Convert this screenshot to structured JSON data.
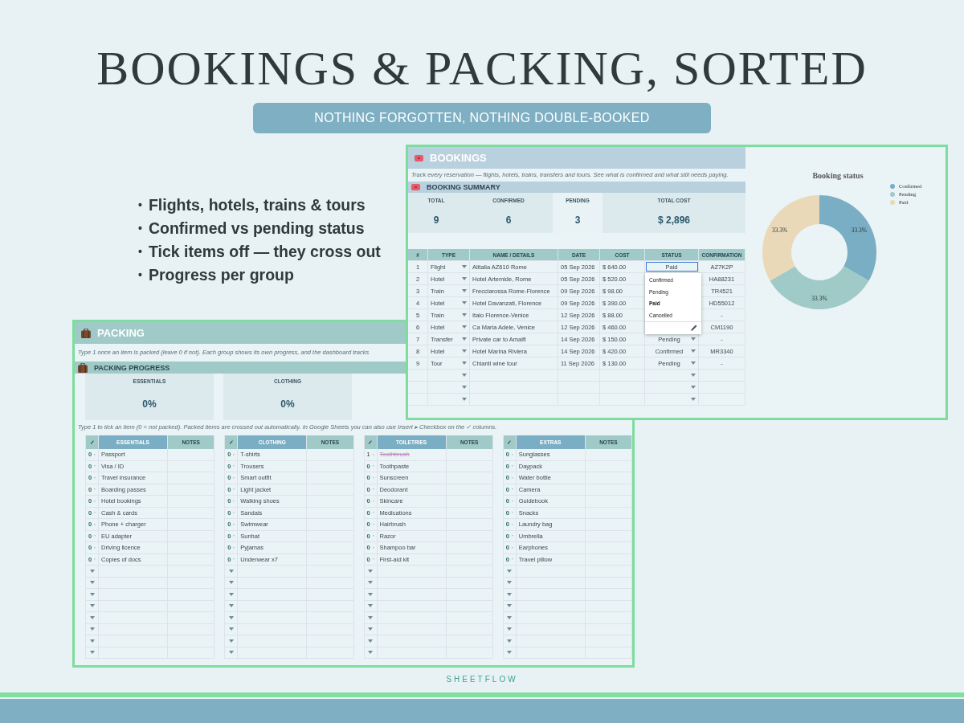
{
  "headline": "BOOKINGS & PACKING, SORTED",
  "tagline": "NOTHING FORGOTTEN, NOTHING DOUBLE-BOOKED",
  "features": [
    {
      "bullet": "•",
      "text": "Flights, hotels, trains & tours"
    },
    {
      "bullet": "•",
      "text": "Confirmed vs pending status"
    },
    {
      "bullet": "•",
      "text": "Tick items off — they cross out"
    },
    {
      "bullet": "•",
      "text": "Progress per group"
    }
  ],
  "packing": {
    "title": "PACKING",
    "description": "Type 1 once an item is packed (leave 0 if not). Each group shows its own progress, and the dashboard tracks",
    "progress_title": "PACKING PROGRESS",
    "progress": [
      {
        "label": "ESSENTIALS",
        "value": "0%"
      },
      {
        "label": "CLOTHING",
        "value": "0%"
      }
    ],
    "note": "Type 1 to tick an item (0 = not packed). Packed items are crossed out automatically. In Google Sheets you can also use Insert ▸ Checkbox on the ✓ columns.",
    "groups": [
      {
        "check_header": "✓",
        "title": "ESSENTIALS",
        "notes_header": "NOTES",
        "blank_rows": [
          {
            "kind": "blank"
          },
          {
            "kind": "blank"
          },
          {
            "kind": "blank"
          },
          {
            "kind": "blank"
          },
          {
            "kind": "blank"
          },
          {
            "kind": "blank"
          },
          {
            "kind": "blank"
          },
          {
            "kind": "blank"
          }
        ],
        "items": [
          {
            "value": "0",
            "name": "Passport",
            "packed": false
          },
          {
            "value": "0",
            "name": "Visa / ID",
            "packed": false
          },
          {
            "value": "0",
            "name": "Travel insurance",
            "packed": false
          },
          {
            "value": "0",
            "name": "Boarding passes",
            "packed": false
          },
          {
            "value": "0",
            "name": "Hotel bookings",
            "packed": false
          },
          {
            "value": "0",
            "name": "Cash & cards",
            "packed": false
          },
          {
            "value": "0",
            "name": "Phone + charger",
            "packed": false
          },
          {
            "value": "0",
            "name": "EU adapter",
            "packed": false
          },
          {
            "value": "0",
            "name": "Driving licence",
            "packed": false
          },
          {
            "value": "0",
            "name": "Copies of docs",
            "packed": false
          }
        ]
      },
      {
        "check_header": "✓",
        "title": "CLOTHING",
        "notes_header": "NOTES",
        "blank_rows": [
          {
            "kind": "blank"
          },
          {
            "kind": "blank"
          },
          {
            "kind": "blank"
          },
          {
            "kind": "blank"
          },
          {
            "kind": "blank"
          },
          {
            "kind": "blank"
          },
          {
            "kind": "blank"
          },
          {
            "kind": "blank"
          }
        ],
        "items": [
          {
            "value": "0",
            "name": "T-shirts",
            "packed": false
          },
          {
            "value": "0",
            "name": "Trousers",
            "packed": false
          },
          {
            "value": "0",
            "name": "Smart outfit",
            "packed": false
          },
          {
            "value": "0",
            "name": "Light jacket",
            "packed": false
          },
          {
            "value": "0",
            "name": "Walking shoes",
            "packed": false
          },
          {
            "value": "0",
            "name": "Sandals",
            "packed": false
          },
          {
            "value": "0",
            "name": "Swimwear",
            "packed": false
          },
          {
            "value": "0",
            "name": "Sunhat",
            "packed": false
          },
          {
            "value": "0",
            "name": "Pyjamas",
            "packed": false
          },
          {
            "value": "0",
            "name": "Underwear x7",
            "packed": false
          }
        ]
      },
      {
        "check_header": "✓",
        "title": "TOILETRIES",
        "notes_header": "NOTES",
        "blank_rows": [
          {
            "kind": "blank"
          },
          {
            "kind": "blank"
          },
          {
            "kind": "blank"
          },
          {
            "kind": "blank"
          },
          {
            "kind": "blank"
          },
          {
            "kind": "blank"
          },
          {
            "kind": "blank"
          },
          {
            "kind": "blank"
          }
        ],
        "items": [
          {
            "value": "1",
            "name": "Toothbrush",
            "packed": true
          },
          {
            "value": "0",
            "name": "Toothpaste",
            "packed": false
          },
          {
            "value": "0",
            "name": "Sunscreen",
            "packed": false
          },
          {
            "value": "0",
            "name": "Deodorant",
            "packed": false
          },
          {
            "value": "0",
            "name": "Skincare",
            "packed": false
          },
          {
            "value": "0",
            "name": "Medications",
            "packed": false
          },
          {
            "value": "0",
            "name": "Hairbrush",
            "packed": false
          },
          {
            "value": "0",
            "name": "Razor",
            "packed": false
          },
          {
            "value": "0",
            "name": "Shampoo bar",
            "packed": false
          },
          {
            "value": "0",
            "name": "First-aid kit",
            "packed": false
          }
        ]
      },
      {
        "check_header": "✓",
        "title": "EXTRAS",
        "notes_header": "NOTES",
        "blank_rows": [
          {
            "kind": "blank"
          },
          {
            "kind": "blank"
          },
          {
            "kind": "blank"
          },
          {
            "kind": "blank"
          },
          {
            "kind": "blank"
          },
          {
            "kind": "blank"
          },
          {
            "kind": "blank"
          },
          {
            "kind": "blank"
          }
        ],
        "items": [
          {
            "value": "0",
            "name": "Sunglasses",
            "packed": false
          },
          {
            "value": "0",
            "name": "Daypack",
            "packed": false
          },
          {
            "value": "0",
            "name": "Water bottle",
            "packed": false
          },
          {
            "value": "0",
            "name": "Camera",
            "packed": false
          },
          {
            "value": "0",
            "name": "Guidebook",
            "packed": false
          },
          {
            "value": "0",
            "name": "Snacks",
            "packed": false
          },
          {
            "value": "0",
            "name": "Laundry bag",
            "packed": false
          },
          {
            "value": "0",
            "name": "Umbrella",
            "packed": false
          },
          {
            "value": "0",
            "name": "Earphones",
            "packed": false
          },
          {
            "value": "0",
            "name": "Travel pillow",
            "packed": false
          }
        ]
      }
    ]
  },
  "bookings": {
    "title": "BOOKINGS",
    "description": "Track every reservation — flights, hotels, trains, transfers and tours. See what is confirmed and what still needs paying.",
    "summary_title": "BOOKING SUMMARY",
    "summary": [
      {
        "label": "TOTAL",
        "value": "9",
        "color": "#dce9ed"
      },
      {
        "label": "CONFIRMED",
        "value": "6",
        "color": "#dce9ed"
      },
      {
        "label": "PENDING",
        "value": "3",
        "color": "#e9f2f4"
      },
      {
        "label": "TOTAL COST",
        "value": "$  2,896",
        "color": "#dce9ed"
      }
    ],
    "table": {
      "columns": [
        "#",
        "TYPE",
        "NAME / DETAILS",
        "DATE",
        "COST",
        "STATUS",
        "CONFIRMATION"
      ],
      "rows": [
        {
          "kind": "entry",
          "num": "1",
          "type": "Flight",
          "name": "Alitalia AZ610 Rome",
          "date": "05 Sep 2026",
          "cost": "$  640.00",
          "status": "Paid",
          "editing": true,
          "confirmation": "AZ7K2P"
        },
        {
          "kind": "entry",
          "num": "2",
          "type": "Hotel",
          "name": "Hotel Artemide, Rome",
          "date": "05 Sep 2026",
          "cost": "$  520.00",
          "confirmation": "HA88231"
        },
        {
          "kind": "entry",
          "num": "3",
          "type": "Train",
          "name": "Frecciarossa Rome-Florence",
          "date": "09 Sep 2026",
          "cost": "$  98.00",
          "confirmation": "TR4521"
        },
        {
          "kind": "entry",
          "num": "4",
          "type": "Hotel",
          "name": "Hotel Davanzati, Florence",
          "date": "09 Sep 2026",
          "cost": "$  390.00",
          "confirmation": "HD55012"
        },
        {
          "kind": "entry",
          "num": "5",
          "type": "Train",
          "name": "Italo Florence-Venice",
          "date": "12 Sep 2026",
          "cost": "$  88.00",
          "confirmation": "-"
        },
        {
          "kind": "entry",
          "num": "6",
          "type": "Hotel",
          "name": "Ca Maria Adele, Venice",
          "date": "12 Sep 2026",
          "cost": "$  460.00",
          "confirmation": "CM1190"
        },
        {
          "kind": "entry",
          "num": "7",
          "type": "Transfer",
          "name": "Private car to Amalfi",
          "date": "14 Sep 2026",
          "cost": "$  150.00",
          "status": "Pending",
          "editing": false,
          "confirmation": "-"
        },
        {
          "kind": "entry",
          "num": "8",
          "type": "Hotel",
          "name": "Hotel Marina Riviera",
          "date": "14 Sep 2026",
          "cost": "$  420.00",
          "status": "Confirmed",
          "editing": false,
          "confirmation": "MR3340"
        },
        {
          "kind": "entry",
          "num": "9",
          "type": "Tour",
          "name": "Chianti wine tour",
          "date": "11 Sep 2026",
          "cost": "$  130.00",
          "status": "Pending",
          "editing": false,
          "confirmation": "-"
        },
        {
          "kind": "blank"
        },
        {
          "kind": "blank"
        },
        {
          "kind": "blank"
        }
      ]
    },
    "status_menu": {
      "options": [
        {
          "label": "Confirmed",
          "selected": false
        },
        {
          "label": "Pending",
          "selected": false
        },
        {
          "label": "Paid",
          "selected": true
        },
        {
          "label": "Cancelled",
          "selected": false
        }
      ]
    },
    "chart": {
      "chart_data": {
        "type": "donut",
        "title": "Booking status",
        "categories": [
          "Confirmed",
          "Pending",
          "Paid"
        ],
        "values": [
          33.3,
          33.3,
          33.3
        ],
        "colors": [
          "#7aaec4",
          "#9fcac7",
          "#e9d9b9"
        ],
        "value_labels": [
          "33.3%",
          "33.3%",
          "33.3%"
        ],
        "legend": "right"
      }
    }
  },
  "brand": "SHEETFLOW"
}
